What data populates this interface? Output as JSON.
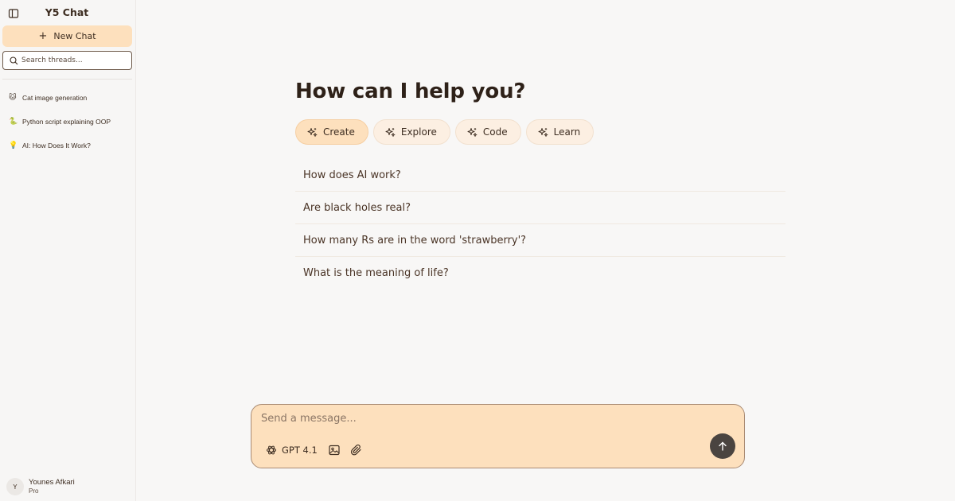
{
  "sidebar": {
    "toggle_icon": "sidebar-toggle-icon",
    "app_title": "Y5 Chat",
    "new_chat_label": "New Chat",
    "search_placeholder": "Search threads...",
    "threads": [
      {
        "emoji": "🐱",
        "label": "Cat image generation"
      },
      {
        "emoji": "🐍",
        "label": "Python script explaining OOP"
      },
      {
        "emoji": "💡",
        "label": "AI: How Does It Work?"
      }
    ],
    "user": {
      "initial": "Y",
      "name": "Younes Afkari",
      "plan": "Pro"
    }
  },
  "main": {
    "title": "How can I help you?",
    "categories": [
      {
        "label": "Create",
        "active": true
      },
      {
        "label": "Explore",
        "active": false
      },
      {
        "label": "Code",
        "active": false
      },
      {
        "label": "Learn",
        "active": false
      }
    ],
    "suggestions": [
      "How does AI work?",
      "Are black holes real?",
      "How many Rs are in the word 'strawberry'?",
      "What is the meaning of life?"
    ]
  },
  "composer": {
    "placeholder": "Send a message...",
    "model_label": "GPT 4.1",
    "icons": [
      "openai-icon",
      "image-icon",
      "paperclip-icon",
      "arrow-up-icon"
    ]
  },
  "colors": {
    "accent": "#fde0bd",
    "accent_soft": "#fcefe2",
    "background": "#f8f7f6",
    "send_button": "#4a4440",
    "text": "#3b2d22"
  }
}
